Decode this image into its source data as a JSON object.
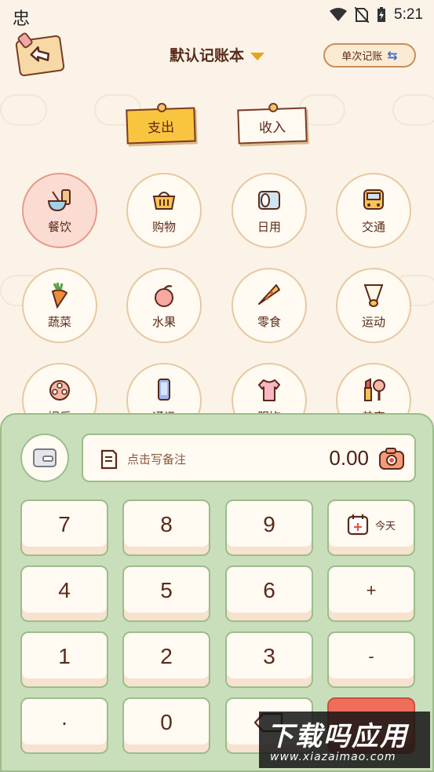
{
  "status_bar": {
    "app_glyph": "忠",
    "time": "5:21"
  },
  "header": {
    "title": "默认记账本",
    "mode_label": "单次记账",
    "mode_icon": "⇆"
  },
  "tabs": {
    "expense": "支出",
    "income": "收入"
  },
  "categories": [
    {
      "label": "餐饮",
      "icon": "meal-icon",
      "active": true
    },
    {
      "label": "购物",
      "icon": "basket-icon"
    },
    {
      "label": "日用",
      "icon": "tissue-icon"
    },
    {
      "label": "交通",
      "icon": "bus-icon"
    },
    {
      "label": "蔬菜",
      "icon": "carrot-icon"
    },
    {
      "label": "水果",
      "icon": "peach-icon"
    },
    {
      "label": "零食",
      "icon": "pizza-icon"
    },
    {
      "label": "运动",
      "icon": "shuttlecock-icon"
    },
    {
      "label": "娱乐",
      "icon": "film-reel-icon"
    },
    {
      "label": "通讯",
      "icon": "phone-icon"
    },
    {
      "label": "服饰",
      "icon": "shirt-icon"
    },
    {
      "label": "美容",
      "icon": "lipstick-icon"
    }
  ],
  "input": {
    "note_placeholder": "点击写备注",
    "amount": "0.00"
  },
  "keypad": {
    "k7": "7",
    "k8": "8",
    "k9": "9",
    "today": "今天",
    "k4": "4",
    "k5": "5",
    "k6": "6",
    "plus": "+",
    "k1": "1",
    "k2": "2",
    "k3": "3",
    "minus": "-",
    "dot": "·",
    "k0": "0"
  },
  "watermark": {
    "main": "下载吗应用",
    "sub": "www.xiazaimao.com"
  },
  "colors": {
    "background": "#fbf3e8",
    "accent_yellow": "#f9c440",
    "panel_green": "#c9dfbc",
    "confirm_red": "#ef6e5a",
    "text_brown": "#5a2a1a"
  }
}
